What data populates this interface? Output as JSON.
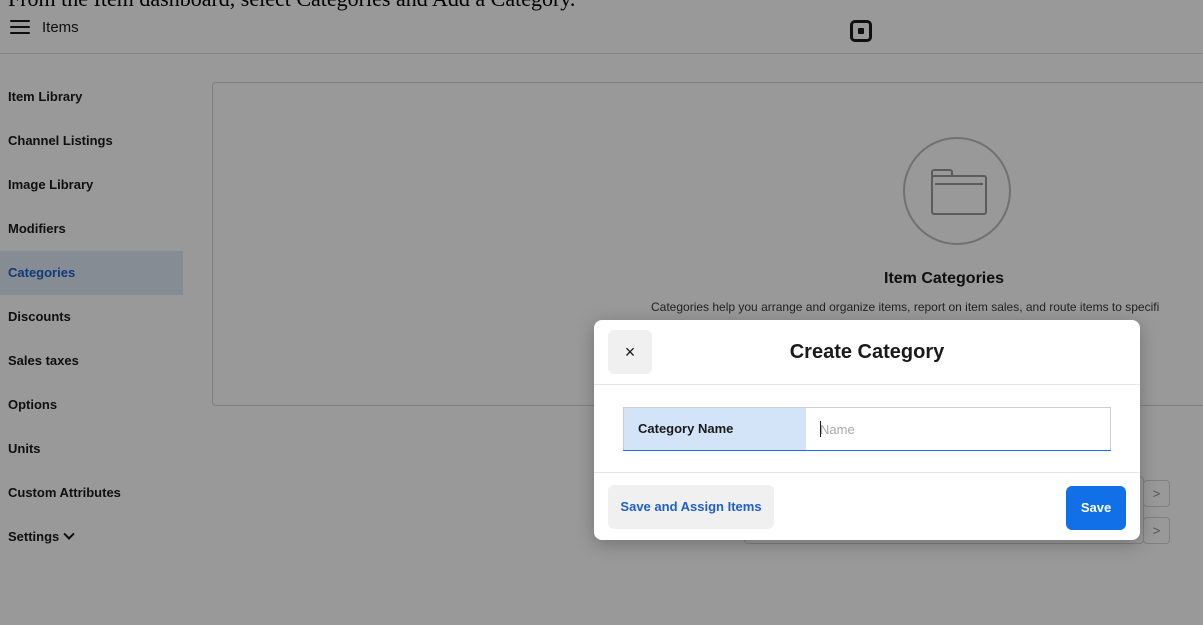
{
  "caption": {
    "text": "From the Item dashboard, select Categories and Add a Category."
  },
  "topbar": {
    "title": "Items",
    "menu_icon": "hamburger-menu-icon",
    "logo_icon": "square-logo-icon"
  },
  "sidebar": {
    "items": [
      {
        "label": "Item Library",
        "active": false
      },
      {
        "label": "Channel Listings",
        "active": false
      },
      {
        "label": "Image Library",
        "active": false
      },
      {
        "label": "Modifiers",
        "active": false
      },
      {
        "label": "Categories",
        "active": true
      },
      {
        "label": "Discounts",
        "active": false
      },
      {
        "label": "Sales taxes",
        "active": false
      },
      {
        "label": "Options",
        "active": false
      },
      {
        "label": "Units",
        "active": false
      },
      {
        "label": "Custom Attributes",
        "active": false
      },
      {
        "label": "Settings",
        "active": false
      }
    ]
  },
  "main": {
    "empty_state_icon": "folder-icon",
    "empty_title": "Item Categories",
    "empty_description": "Categories help you arrange and organize items, report on item sales, and route items to specifi",
    "pager": {
      "next_label": ">"
    }
  },
  "modal": {
    "title": "Create Category",
    "close_label": "×",
    "field": {
      "label": "Category Name",
      "placeholder": "Name",
      "value": ""
    },
    "secondary_button": "Save and Assign Items",
    "primary_button": "Save"
  },
  "colors": {
    "accent": "#1170e8",
    "active_nav_bg": "#dfe9f7",
    "field_label_bg": "#d3e4f8",
    "overlay": "rgba(0,0,0,0.40)"
  }
}
